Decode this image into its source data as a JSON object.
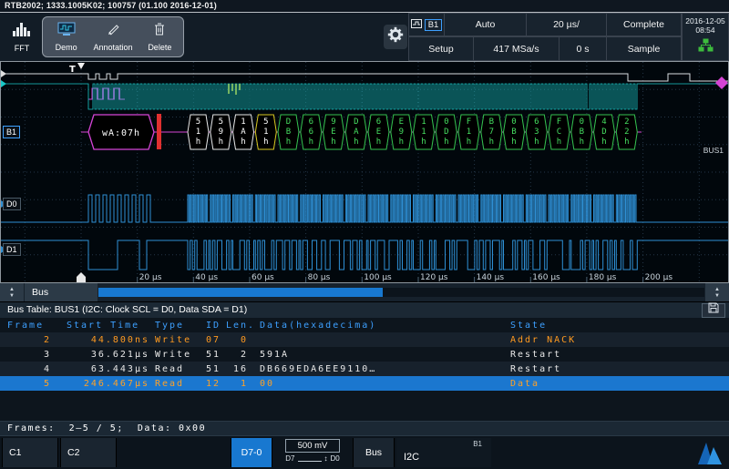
{
  "device_bar": {
    "text": "RTB2002; 1333.1005K02; 100757 (01.100 2016-12-01)"
  },
  "toolbar": {
    "fft": "FFT",
    "demo": "Demo",
    "annotation": "Annotation",
    "delete": "Delete"
  },
  "status_panel": {
    "b1": "B1",
    "row1": [
      {
        "label": "Auto"
      },
      {
        "label": "20 µs/"
      },
      {
        "label": "Complete"
      }
    ],
    "row2": [
      {
        "label": "Setup"
      },
      {
        "label": "417 MSa/s"
      },
      {
        "label": "0 s"
      },
      {
        "label": "Sample"
      }
    ],
    "date": "2016-12-05",
    "time": "08:54"
  },
  "waveform": {
    "trigger_label": "T",
    "b1_badge": "B1",
    "bus1_label": "BUS1",
    "d0_label": "D0",
    "d1_label": "D1",
    "time_labels": [
      "20 µs",
      "40 µs",
      "60 µs",
      "80 µs",
      "100 µs",
      "120 µs",
      "140 µs",
      "160 µs",
      "180 µs",
      "200 µs"
    ],
    "decode": {
      "address_frame": "wA:07h",
      "frames": [
        {
          "label": "51h",
          "kind": "id"
        },
        {
          "label": "59h",
          "kind": "id"
        },
        {
          "label": "1Ah",
          "kind": "id"
        },
        {
          "label": "51h",
          "kind": "id_read"
        },
        {
          "label": "DBh",
          "kind": "data"
        },
        {
          "label": "66h",
          "kind": "data"
        },
        {
          "label": "9Eh",
          "kind": "data"
        },
        {
          "label": "DAh",
          "kind": "data"
        },
        {
          "label": "6Eh",
          "kind": "data"
        },
        {
          "label": "E9h",
          "kind": "data"
        },
        {
          "label": "11h",
          "kind": "data"
        },
        {
          "label": "0Dh",
          "kind": "data"
        },
        {
          "label": "F1h",
          "kind": "data"
        },
        {
          "label": "B7h",
          "kind": "data"
        },
        {
          "label": "0Bh",
          "kind": "data"
        },
        {
          "label": "63h",
          "kind": "data"
        },
        {
          "label": "FCh",
          "kind": "data"
        },
        {
          "label": "0Bh",
          "kind": "data"
        },
        {
          "label": "4Dh",
          "kind": "data"
        },
        {
          "label": "22h",
          "kind": "data"
        }
      ]
    },
    "colors": {
      "address": "#d544d5",
      "id": "#e8e8e8",
      "id_read": "#d8c820",
      "data": "#35c24f",
      "data_text": "#45dd60",
      "nack": "#e03030",
      "digital": "#2e8fd4",
      "analog": "#19c8c8"
    }
  },
  "bus_scroll": {
    "tab": "Bus"
  },
  "bus_table": {
    "title": "Bus Table: BUS1 (I2C: Clock SCL = D0, Data SDA = D1)",
    "columns": [
      "Frame",
      "Start Time",
      "Type",
      "ID",
      "Len.",
      "Data(hexadecima)",
      "State"
    ],
    "rows": [
      {
        "frame": "2",
        "start": "44.800ns",
        "type": "Write",
        "id": "07",
        "len": "0",
        "data": "",
        "state": "Addr NACK",
        "style": "warn"
      },
      {
        "frame": "3",
        "start": "36.621µs",
        "type": "Write",
        "id": "51",
        "len": "2",
        "data": "591A",
        "state": "Restart",
        "style": "normal"
      },
      {
        "frame": "4",
        "start": "63.443µs",
        "type": "Read",
        "id": "51",
        "len": "16",
        "data": "DB669EDA6EE9110…",
        "state": "Restart",
        "style": "normal"
      },
      {
        "frame": "5",
        "start": "246.467µs",
        "type": "Read",
        "id": "12",
        "len": "1",
        "data": "00",
        "state": "Data",
        "style": "selected"
      }
    ],
    "summary": "Frames:  2–5 / 5;  Data: 0x00"
  },
  "bottom_bar": {
    "c1": "C1",
    "c2": "C2",
    "d70": "D7-0",
    "threshold": "500 mV",
    "d7": "D7",
    "d0": "D0",
    "bus": "Bus",
    "i2c": "I2C",
    "b1": "B1"
  }
}
